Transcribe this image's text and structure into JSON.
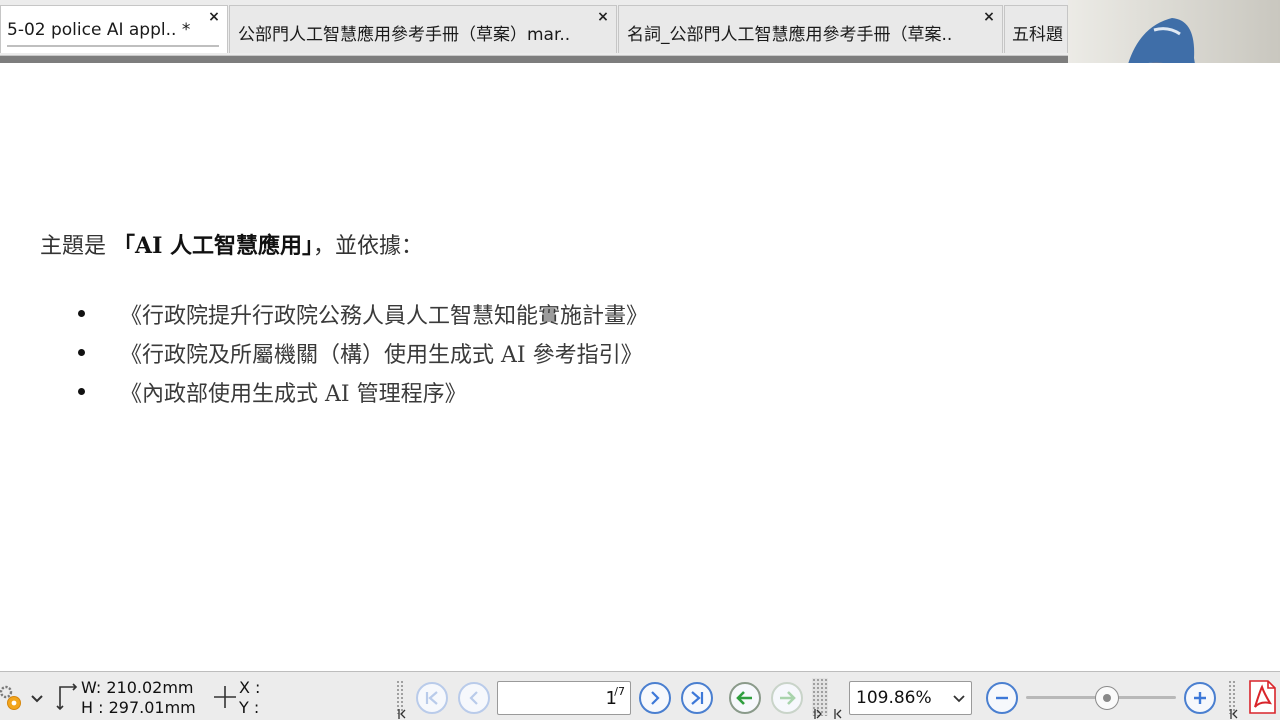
{
  "tabs": [
    {
      "label": "5-02  police AI appl..  *",
      "active": true
    },
    {
      "label": "公部門人工智慧應用參考手冊（草案）mar.."
    },
    {
      "label": "名詞_公部門人工智慧應用參考手冊（草案.."
    },
    {
      "label": "五科題"
    }
  ],
  "close_glyph": "×",
  "document": {
    "heading_prefix": "主題是 ",
    "heading_topic": "「AI 人工智慧應用」",
    "heading_suffix": "，並依據：",
    "references": [
      "《行政院提升行政院公務人員人工智慧知能實施計畫》",
      "《行政院及所屬機關（構）使用生成式 AI 參考指引》",
      "《內政部使用生成式 AI 管理程序》"
    ]
  },
  "statusbar": {
    "width": "W: 210.02mm",
    "height": "H : 297.01mm",
    "x_label": "X :",
    "y_label": "Y :",
    "page_current": "1",
    "page_total": "7",
    "zoom": "109.86%",
    "zoom_slider_percent": 55
  },
  "colors": {
    "accent": "#3d78d8",
    "nav_green": "#2f9e3f",
    "pdf_red": "#d9252b"
  }
}
